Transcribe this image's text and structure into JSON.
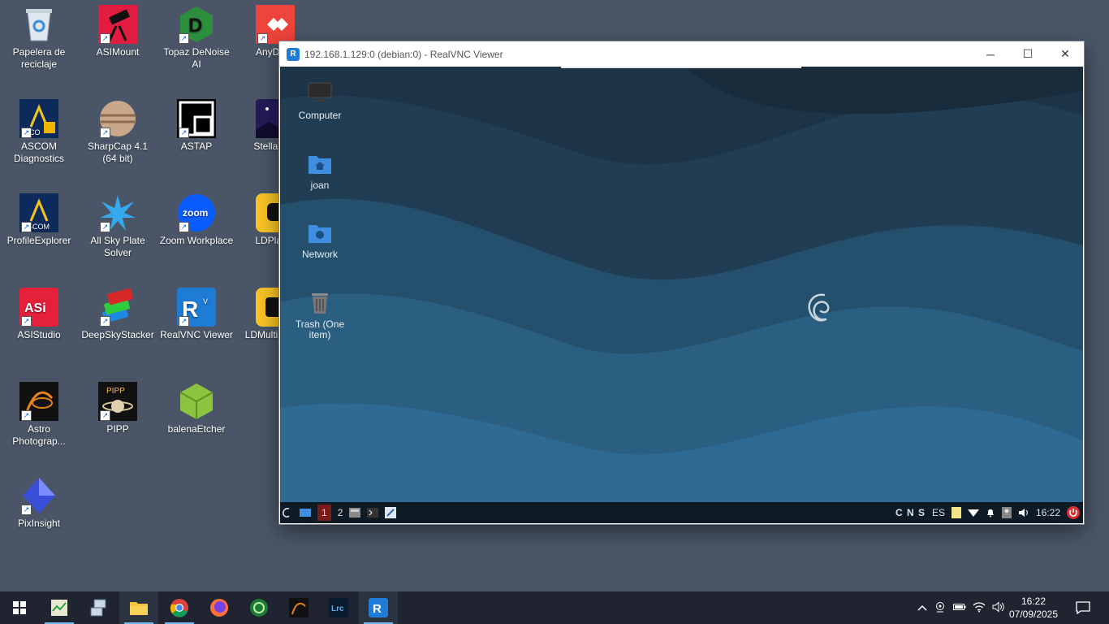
{
  "desktop_icons": [
    {
      "label": "Papelera de reciclaje",
      "icon": "recycle-bin-icon"
    },
    {
      "label": "ASIMount",
      "icon": "asimount-icon"
    },
    {
      "label": "Topaz DeNoise AI",
      "icon": "topaz-denoise-icon"
    },
    {
      "label": "AnyDesk",
      "icon": "anydesk-icon"
    },
    {
      "label": "ASCOM Diagnostics",
      "icon": "ascom-diagnostics-icon"
    },
    {
      "label": "SharpCap 4.1 (64 bit)",
      "icon": "sharpcap-icon"
    },
    {
      "label": "ASTAP",
      "icon": "astap-icon"
    },
    {
      "label": "Stellarium",
      "icon": "stellarium-icon"
    },
    {
      "label": "ProfileExplorer",
      "icon": "profile-explorer-icon"
    },
    {
      "label": "All Sky Plate Solver",
      "icon": "all-sky-plate-solver-icon"
    },
    {
      "label": "Zoom Workplace",
      "icon": "zoom-icon"
    },
    {
      "label": "LDPlayer",
      "icon": "ldplayer-icon"
    },
    {
      "label": "ASIStudio",
      "icon": "asistudio-icon"
    },
    {
      "label": "DeepSkyStacker",
      "icon": "deepskystacker-icon"
    },
    {
      "label": "RealVNC Viewer",
      "icon": "realvnc-viewer-icon"
    },
    {
      "label": "LDMultiPlayer",
      "icon": "ldmultiplayer-icon"
    },
    {
      "label": "Astro Photograp...",
      "icon": "astro-photography-tool-icon"
    },
    {
      "label": "PIPP",
      "icon": "pipp-icon"
    },
    {
      "label": "balenaEtcher",
      "icon": "balena-etcher-icon"
    },
    {
      "label": "PixInsight",
      "icon": "pixinsight-icon"
    }
  ],
  "vnc_window": {
    "title": "192.168.1.129:0 (debian:0) - RealVNC Viewer",
    "app_icon_text": "R",
    "minimize": "─",
    "maximize": "☐",
    "close": "✕"
  },
  "remote_desktop": {
    "icons": [
      {
        "label": "Computer",
        "icon": "computer-icon"
      },
      {
        "label": "joan",
        "icon": "home-folder-icon"
      },
      {
        "label": "Network",
        "icon": "network-folder-icon"
      },
      {
        "label": "Trash (One item)",
        "icon": "trash-icon"
      }
    ],
    "panel": {
      "workspace_1": "1",
      "workspace_2": "2",
      "lock_indicators": "C N S",
      "keyboard_layout": "ES",
      "time": "16:22"
    }
  },
  "taskbar": {
    "apps": [
      {
        "name": "task-manager-icon",
        "active": true
      },
      {
        "name": "network-computer-icon",
        "active": false
      },
      {
        "name": "file-explorer-icon",
        "active": true
      },
      {
        "name": "chrome-icon",
        "active": true
      },
      {
        "name": "firefox-icon",
        "active": false
      },
      {
        "name": "app-green-icon",
        "active": false
      },
      {
        "name": "astro-photography-tool-icon",
        "active": false
      },
      {
        "name": "lightroom-classic-icon",
        "active": false,
        "text": "Lrc"
      },
      {
        "name": "realvnc-viewer-icon",
        "active": true
      }
    ],
    "clock_time": "16:22",
    "clock_date": "07/09/2025"
  },
  "colors": {
    "desktop_bg": "#4a5667",
    "taskbar_bg": "#1f2430",
    "debian_wave_dark": "#1d3447",
    "debian_wave_light": "#2f6a94",
    "accent": "#76b9ed"
  }
}
